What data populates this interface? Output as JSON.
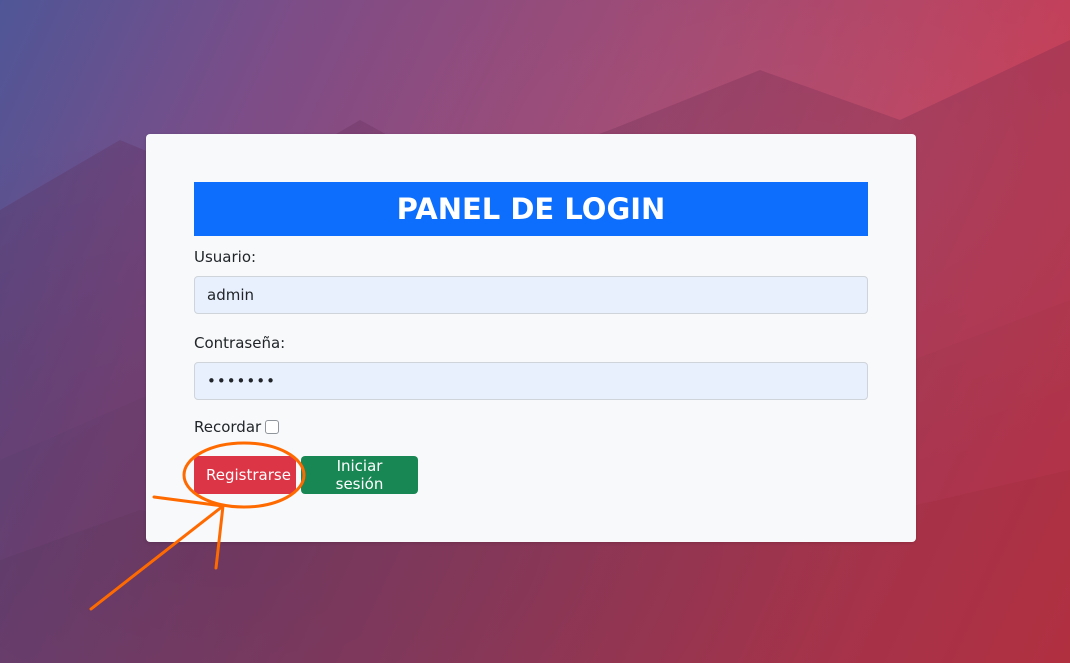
{
  "login_panel": {
    "title": "PANEL DE LOGIN",
    "username_label": "Usuario:",
    "username_value": "admin",
    "password_label": "Contraseña:",
    "password_value": "•••••••",
    "remember_label": "Recordar",
    "remember_checked": false,
    "register_label": "Registrarse",
    "login_label": "Iniciar sesión"
  },
  "colors": {
    "title_bg": "#0d6efd",
    "register_btn": "#dc3545",
    "login_btn": "#198754",
    "annotation": "#ff6a00",
    "card_bg": "#f8f9fa"
  }
}
